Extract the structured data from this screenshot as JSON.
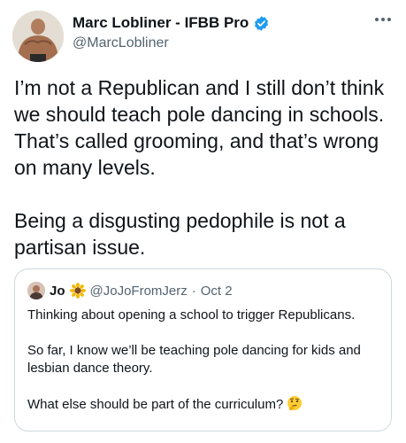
{
  "tweet": {
    "author": {
      "display_name": "Marc Lobliner - IFBB Pro",
      "handle": "@MarcLobliner",
      "verified": true
    },
    "more_icon": "more-icon",
    "paragraphs": [
      "I’m not a Republican and I still don’t think we should teach pole dancing in schools. That’s called grooming, and that’s wrong on many levels.",
      "Being a disgusting pedophile is not a partisan issue."
    ]
  },
  "quote": {
    "name": "Jo",
    "name_emoji": "sunflower-icon",
    "handle": "@JoJoFromJerz",
    "separator": "·",
    "date": "Oct 2",
    "paragraphs": [
      "Thinking about opening a school to trigger Republicans.",
      "So far, I know we’ll be teaching pole dancing for kids and lesbian dance theory.",
      "What else should be part of the curriculum?"
    ],
    "trailing_emoji": "thinking-face-icon"
  },
  "colors": {
    "text": "#0f1419",
    "secondary": "#536471",
    "verified": "#1d9bf0",
    "border": "#cfd9de"
  }
}
